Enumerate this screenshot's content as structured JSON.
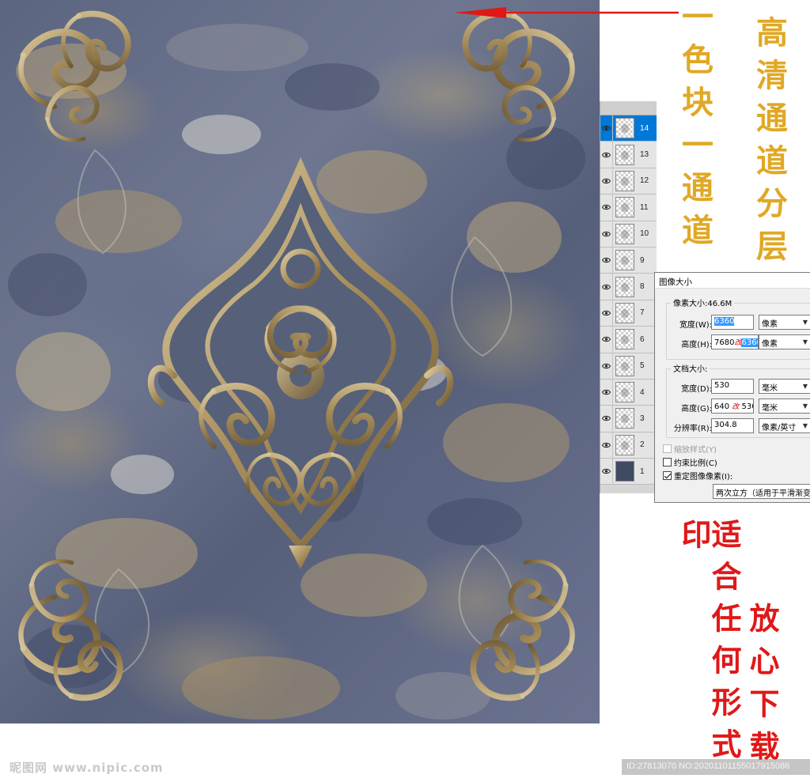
{
  "side_text": {
    "color_channel": "一色块一通道",
    "hd_layers": "高清通道分层",
    "print": "适合任何形式印",
    "download": "放心下载"
  },
  "layers": [
    {
      "num": "14",
      "selected": true
    },
    {
      "num": "13"
    },
    {
      "num": "12"
    },
    {
      "num": "11"
    },
    {
      "num": "10"
    },
    {
      "num": "9"
    },
    {
      "num": "8"
    },
    {
      "num": "7"
    },
    {
      "num": "6"
    },
    {
      "num": "5"
    },
    {
      "num": "4"
    },
    {
      "num": "3"
    },
    {
      "num": "2"
    },
    {
      "num": "1",
      "solid": true
    }
  ],
  "dialog": {
    "title": "图像大小",
    "pixel_size_label": "像素大小:46.6M",
    "pixel_width_label": "宽度(W):",
    "pixel_width_value": "6360",
    "pixel_width_unit": "像素",
    "pixel_height_label": "高度(H):",
    "pixel_height_old": "7680",
    "pixel_height_note": "改",
    "pixel_height_value": "6360",
    "pixel_height_unit": "像素",
    "doc_size_label": "文档大小:",
    "doc_width_label": "宽度(D):",
    "doc_width_value": "530",
    "doc_width_unit": "毫米",
    "doc_height_label": "高度(G):",
    "doc_height_old": "640",
    "doc_height_note": "改",
    "doc_height_value": "530",
    "doc_height_unit": "毫米",
    "resolution_label": "分辨率(R):",
    "resolution_value": "304.8",
    "resolution_unit": "像素/英寸",
    "scale_styles_label": "缩放样式(Y)",
    "constrain_label": "约束比例(C)",
    "resample_label": "重定图像像素(I):",
    "resample_value": "两次立方（适用于平滑渐变"
  },
  "footer": {
    "logo": "昵图网 www.nipic.com",
    "id_text": "ID:27813070 NO:20201101155017915086"
  },
  "colors": {
    "gold": "#e0a825",
    "red": "#e01818",
    "selection_blue": "#0078d7"
  }
}
